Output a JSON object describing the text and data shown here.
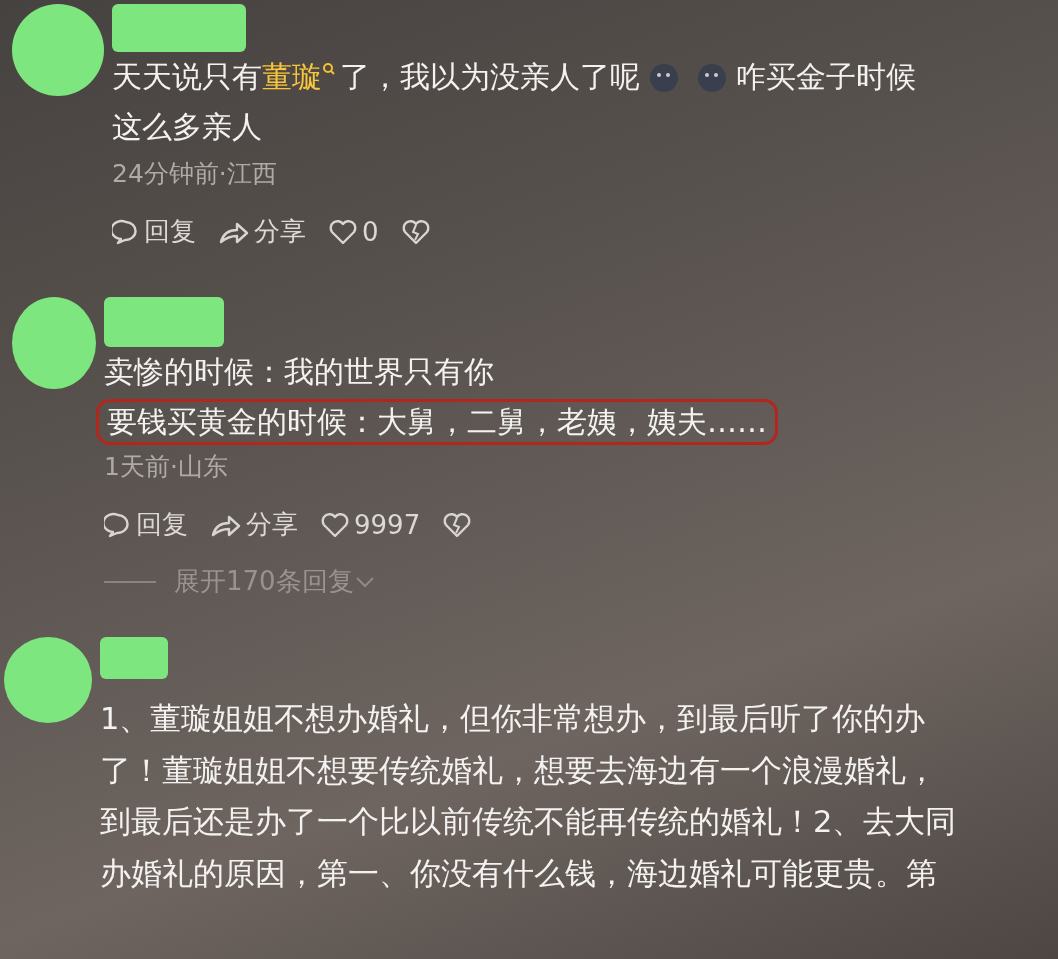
{
  "comments": [
    {
      "lines": [
        {
          "highlighted": false,
          "segments": [
            {
              "kind": "text",
              "text": "天天说只有"
            },
            {
              "kind": "keyword",
              "text": "董璇"
            },
            {
              "kind": "text",
              "text": "了，我以为没亲人了呢"
            },
            {
              "kind": "emoji"
            },
            {
              "kind": "emoji"
            },
            {
              "kind": "text",
              "text": "咋买金子时候"
            }
          ]
        },
        {
          "highlighted": false,
          "segments": [
            {
              "kind": "text",
              "text": "这么多亲人"
            }
          ]
        }
      ],
      "meta": "24分钟前·江西",
      "actions": {
        "reply": "回复",
        "share": "分享",
        "likes": "0"
      }
    },
    {
      "lines": [
        {
          "highlighted": false,
          "segments": [
            {
              "kind": "text",
              "text": "卖惨的时候：我的世界只有你"
            }
          ]
        },
        {
          "highlighted": true,
          "segments": [
            {
              "kind": "text",
              "text": "要钱买黄金的时候：大舅，二舅，老姨，姨夫……"
            }
          ]
        }
      ],
      "meta": "1天前·山东",
      "actions": {
        "reply": "回复",
        "share": "分享",
        "likes": "9997"
      },
      "expand": "展开170条回复"
    },
    {
      "lines": [
        {
          "highlighted": false,
          "segments": [
            {
              "kind": "text",
              "text": "1、董璇姐姐不想办婚礼，但你非常想办，到最后听了你的办"
            }
          ]
        },
        {
          "highlighted": false,
          "segments": [
            {
              "kind": "text",
              "text": "了！董璇姐姐不想要传统婚礼，想要去海边有一个浪漫婚礼，"
            }
          ]
        },
        {
          "highlighted": false,
          "segments": [
            {
              "kind": "text",
              "text": "到最后还是办了一个比以前传统不能再传统的婚礼！2、去大同"
            }
          ]
        },
        {
          "highlighted": false,
          "segments": [
            {
              "kind": "text",
              "text": "办婚礼的原因，第一、你没有什么钱，海边婚礼可能更贵。第"
            }
          ]
        }
      ]
    }
  ]
}
